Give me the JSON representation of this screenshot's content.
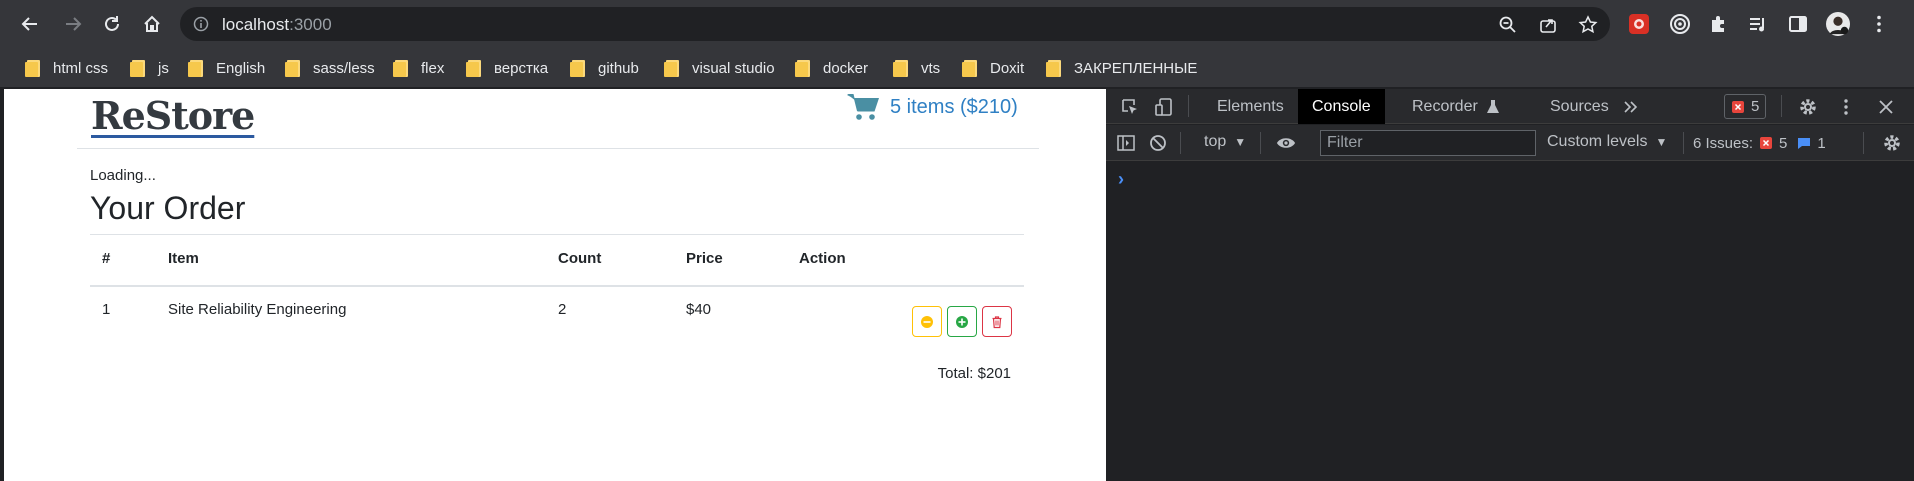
{
  "browser": {
    "url_host": "localhost",
    "url_port": ":3000",
    "nav_icons": [
      "back-icon",
      "forward-icon",
      "reload-icon",
      "home-icon"
    ],
    "omnibox_icons": [
      "info-icon",
      "zoom-icon",
      "share-icon",
      "star-icon"
    ],
    "extension_icons": [
      "extension-red-icon",
      "extension-target-icon",
      "puzzle-icon",
      "media-icon",
      "side-panel-icon",
      "profile-avatar",
      "menu-icon"
    ]
  },
  "bookmarks": [
    {
      "label": "html css"
    },
    {
      "label": "js"
    },
    {
      "label": "English"
    },
    {
      "label": "sass/less"
    },
    {
      "label": "flex"
    },
    {
      "label": "верстка"
    },
    {
      "label": "github"
    },
    {
      "label": "visual studio"
    },
    {
      "label": "docker"
    },
    {
      "label": "vts"
    },
    {
      "label": "Doxit"
    },
    {
      "label": "ЗАКРЕПЛЕННЫЕ"
    }
  ],
  "app": {
    "brand": "ReStore",
    "cart_label": "5 items ($210)",
    "loading_text": "Loading...",
    "order_title": "Your Order",
    "table": {
      "headers": [
        "#",
        "Item",
        "Count",
        "Price",
        "Action"
      ],
      "rows": [
        {
          "num": "1",
          "item": "Site Reliability Engineering",
          "count": "2",
          "price": "$40"
        }
      ]
    },
    "total": "Total: $201",
    "colors": {
      "warning": "#ffc107",
      "success": "#28a745",
      "danger": "#dc3545",
      "link": "#2f80c4"
    }
  },
  "devtools": {
    "tabs": [
      "Elements",
      "Console",
      "Recorder",
      "Sources"
    ],
    "active_tab": "Console",
    "error_count": "5",
    "context": "top",
    "filter_placeholder": "Filter",
    "levels": "Custom levels",
    "issues_label": "6 Issues:",
    "issues_errors": "5",
    "issues_info": "1",
    "prompt": "›"
  }
}
